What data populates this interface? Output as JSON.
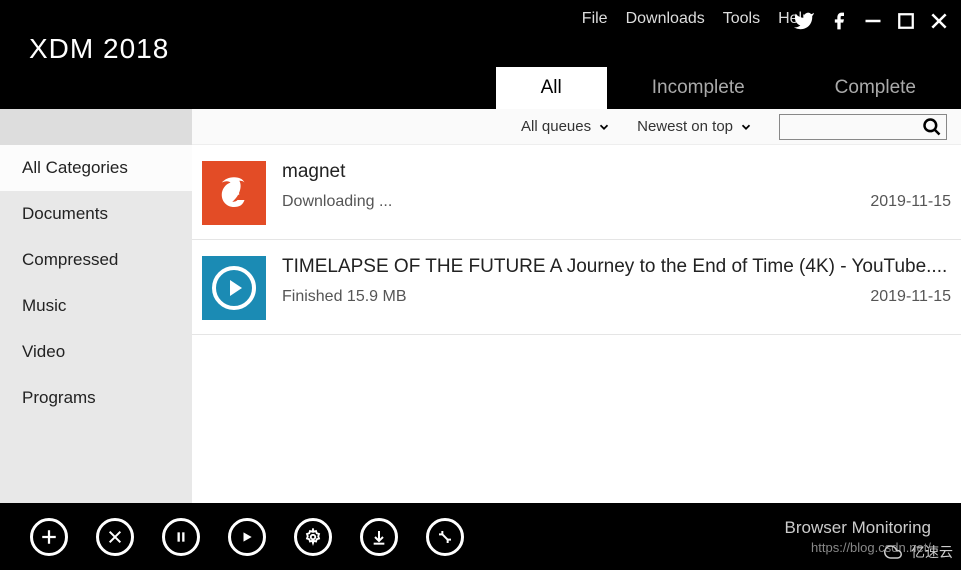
{
  "app": {
    "title": "XDM 2018"
  },
  "menu": {
    "file": "File",
    "downloads": "Downloads",
    "tools": "Tools",
    "help": "Help"
  },
  "tabs": {
    "all": "All",
    "incomplete": "Incomplete",
    "complete": "Complete"
  },
  "sidebar": {
    "items": [
      {
        "label": "All Categories",
        "selected": true
      },
      {
        "label": "Documents",
        "selected": false
      },
      {
        "label": "Compressed",
        "selected": false
      },
      {
        "label": "Music",
        "selected": false
      },
      {
        "label": "Video",
        "selected": false
      },
      {
        "label": "Programs",
        "selected": false
      }
    ]
  },
  "toolbar": {
    "queues": "All queues",
    "sort": "Newest on top",
    "search_placeholder": ""
  },
  "downloads": [
    {
      "title": "magnet",
      "status": "Downloading ...",
      "date": "2019-11-15",
      "icon": "ie"
    },
    {
      "title": "TIMELAPSE OF THE FUTURE A Journey to the End of Time (4K) - YouTube....",
      "status": "Finished 15.9 MB",
      "date": "2019-11-15",
      "icon": "play"
    }
  ],
  "footer": {
    "monitoring": "Browser Monitoring",
    "url": "https://blog.csdn.net/"
  },
  "watermark": "亿速云",
  "colors": {
    "header_bg": "#000000",
    "sidebar_bg": "#e8e8e8",
    "ie_orange": "#e34c26",
    "play_blue": "#1b8bb4"
  }
}
